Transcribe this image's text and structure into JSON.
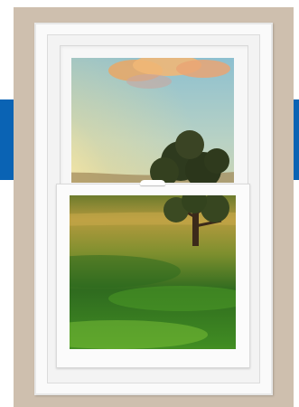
{
  "image": {
    "subject": "white-double-hung-window",
    "colors": {
      "wall": "#cebfae",
      "frame": "#fafafa",
      "accent_tabs": "#0a63b4",
      "sky_top": "#6fb3d8",
      "sun": "#fff4c2",
      "grass": "#4e9a27",
      "tree": "#3b2a1a"
    }
  }
}
